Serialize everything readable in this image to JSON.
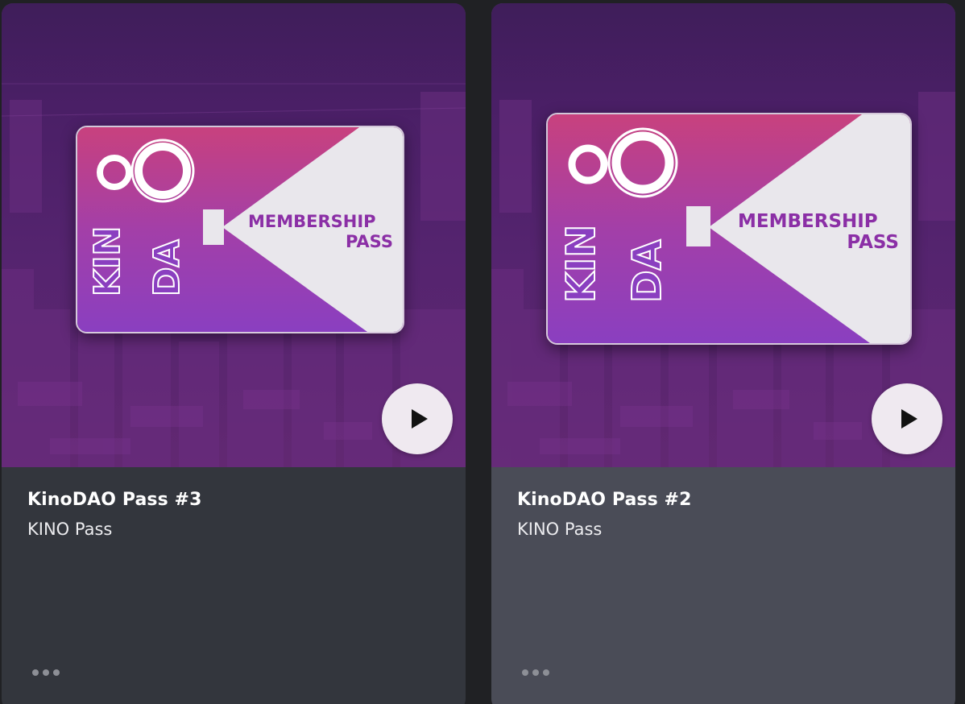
{
  "cards": [
    {
      "title": "KinoDAO Pass #3",
      "collection": "KINO Pass",
      "pass_art": {
        "logo_text": "KINO DAO",
        "headline_line1": "MEMBERSHIP",
        "headline_line2": "PASS"
      },
      "play_icon": "play-icon",
      "more_icon": "more-horizontal-icon"
    },
    {
      "title": "KinoDAO Pass #2",
      "collection": "KINO Pass",
      "pass_art": {
        "logo_text": "KINO DAO",
        "headline_line1": "MEMBERSHIP",
        "headline_line2": "PASS"
      },
      "play_icon": "play-icon",
      "more_icon": "more-horizontal-icon"
    }
  ],
  "colors": {
    "page_background": "#202124",
    "card1_background": "#33363d",
    "card2_background": "#4a4c57",
    "media_purple": "#55246f",
    "pass_pink": "#c8417e",
    "pass_violet": "#8a3fc0",
    "pass_headline": "#8b2fa6",
    "play_button": "#efe9f0"
  }
}
